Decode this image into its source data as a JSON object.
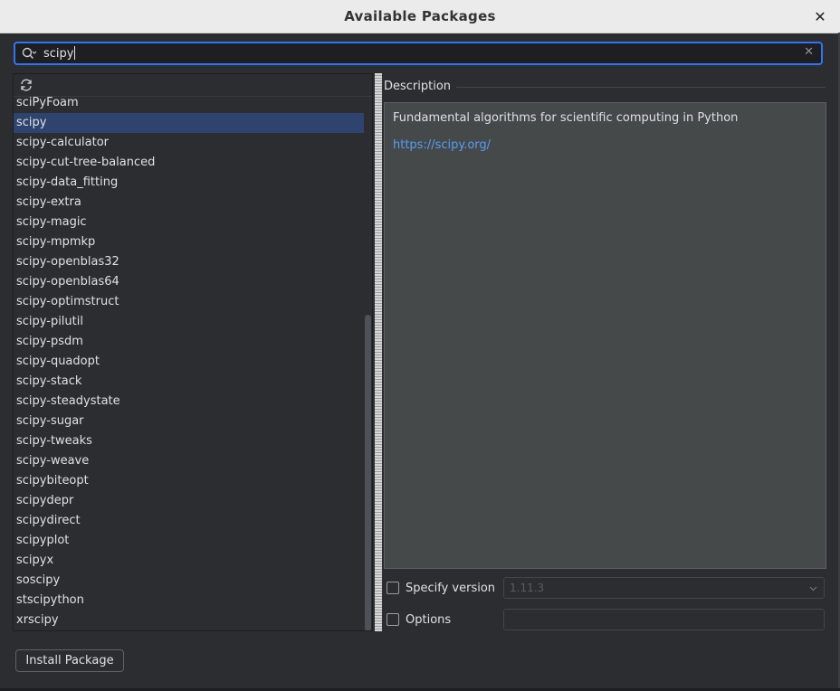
{
  "dialog": {
    "title": "Available Packages",
    "close_glyph": "✕"
  },
  "search": {
    "value": "scipy",
    "clear_glyph": "✕"
  },
  "packages": {
    "items": [
      "sciPyFoam",
      "scipy",
      "scipy-calculator",
      "scipy-cut-tree-balanced",
      "scipy-data_fitting",
      "scipy-extra",
      "scipy-magic",
      "scipy-mpmkp",
      "scipy-openblas32",
      "scipy-openblas64",
      "scipy-optimstruct",
      "scipy-pilutil",
      "scipy-psdm",
      "scipy-quadopt",
      "scipy-stack",
      "scipy-steadystate",
      "scipy-sugar",
      "scipy-tweaks",
      "scipy-weave",
      "scipybiteopt",
      "scipydepr",
      "scipydirect",
      "scipyplot",
      "scipyx",
      "soscipy",
      "stscipython",
      "xrscipy"
    ],
    "selected": "scipy"
  },
  "description": {
    "legend": "Description",
    "text": "Fundamental algorithms for scientific computing in Python",
    "link": "https://scipy.org/"
  },
  "options": {
    "specify_version_label": "Specify version",
    "version_value": "1.11.3",
    "options_label": "Options"
  },
  "install_button": "Install Package",
  "colors": {
    "accent": "#3574f0",
    "selection": "#2e436e",
    "link": "#589df6"
  }
}
